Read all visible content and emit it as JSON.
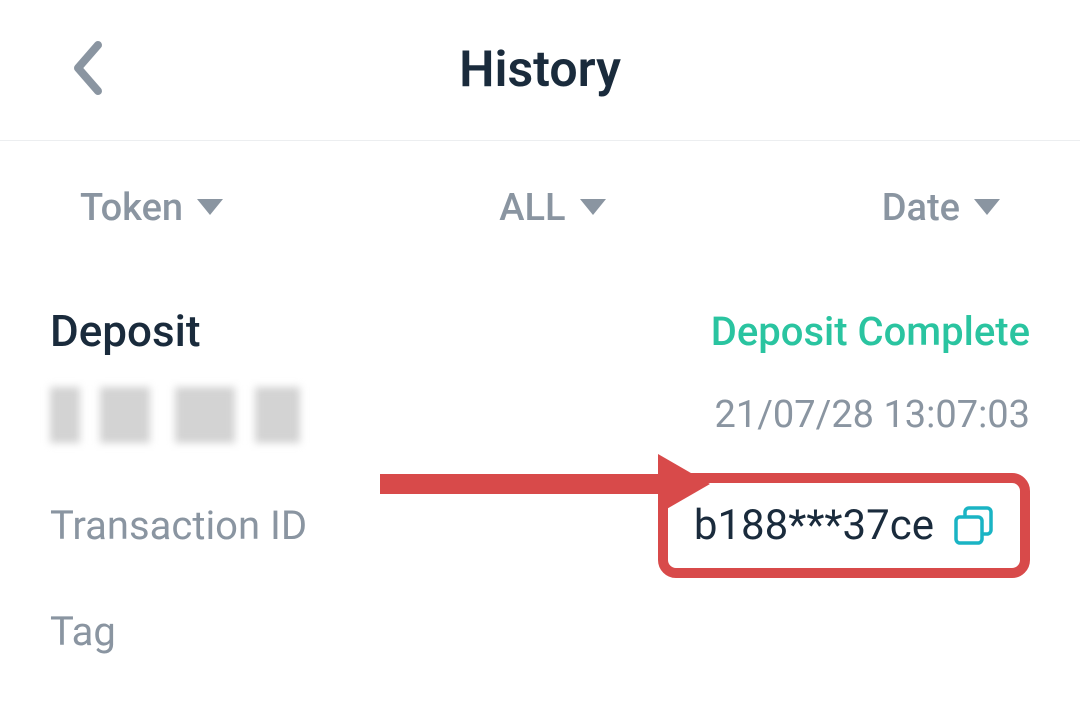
{
  "header": {
    "title": "History"
  },
  "filters": {
    "token_label": "Token",
    "all_label": "ALL",
    "date_label": "Date"
  },
  "transaction": {
    "type_label": "Deposit",
    "status_label": "Deposit Complete",
    "timestamp": "21/07/28 13:07:03",
    "txid_label": "Transaction ID",
    "txid_value": "b188***37ce",
    "tag_label": "Tag"
  },
  "colors": {
    "accent_green": "#2ac4a0",
    "accent_red": "#d84a4a",
    "primary_text": "#1a2b3c",
    "muted_text": "#8a95a1",
    "copy_icon": "#1ab4c4"
  }
}
